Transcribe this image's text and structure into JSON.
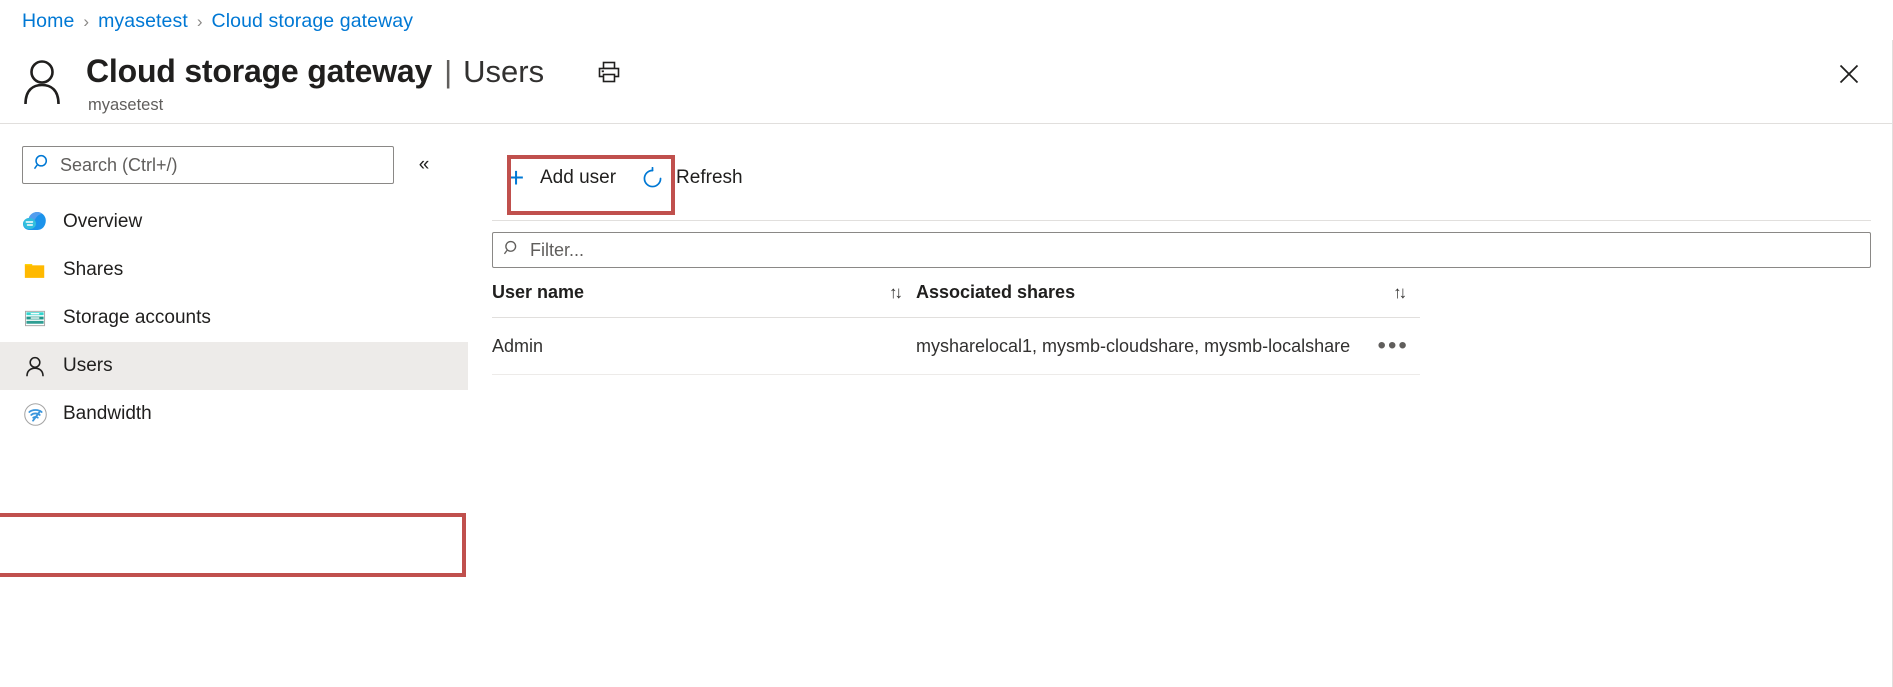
{
  "breadcrumb": {
    "separator": "›",
    "items": [
      {
        "label": "Home"
      },
      {
        "label": "myasetest"
      },
      {
        "label": "Cloud storage gateway"
      }
    ]
  },
  "header": {
    "avatar_icon": "person-icon",
    "title": "Cloud storage gateway",
    "title_separator": "|",
    "page": "Users",
    "subtitle": "myasetest",
    "print_icon": "print-icon",
    "close_icon": "close-icon"
  },
  "sidebar": {
    "search": {
      "placeholder": "Search (Ctrl+/)",
      "value": "",
      "icon": "search-icon"
    },
    "collapse_icon": "«",
    "items": [
      {
        "label": "Overview",
        "icon": "cloud-icon",
        "selected": false
      },
      {
        "label": "Shares",
        "icon": "folder-icon",
        "selected": false
      },
      {
        "label": "Storage accounts",
        "icon": "storage-account-icon",
        "selected": false
      },
      {
        "label": "Users",
        "icon": "person-icon",
        "selected": true
      },
      {
        "label": "Bandwidth",
        "icon": "bandwidth-icon",
        "selected": false
      }
    ]
  },
  "toolbar": {
    "add_user_label": "Add user",
    "add_user_icon": "plus-icon",
    "refresh_label": "Refresh",
    "refresh_icon": "refresh-icon"
  },
  "filter": {
    "placeholder": "Filter...",
    "value": "",
    "icon": "search-icon"
  },
  "table": {
    "columns": [
      {
        "label": "User name",
        "sort_icon": "↑↓"
      },
      {
        "label": "Associated shares",
        "sort_icon": "↑↓"
      }
    ],
    "rows": [
      {
        "user_name": "Admin",
        "associated_shares": "mysharelocal1, mysmb-cloudshare, mysmb-localshare",
        "actions_icon": "•••"
      }
    ]
  },
  "annotations": {
    "color": "#c0504d",
    "boxes": [
      {
        "name": "users-nav-highlight"
      },
      {
        "name": "add-user-highlight"
      }
    ]
  },
  "colors": {
    "link": "#0078d4",
    "accent": "#0078d4",
    "selected_bg": "#edebe9",
    "annotation": "#c0504d",
    "folder": "#ffb900"
  }
}
